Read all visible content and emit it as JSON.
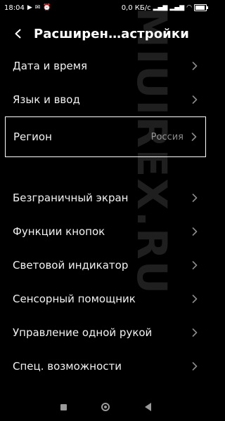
{
  "status": {
    "time": "18:04",
    "left_icons": [
      "play-icon",
      "notification-icon",
      "alarm-icon"
    ],
    "speed": "0,0 КБ/с",
    "right_icons": [
      "signal-icon",
      "signal-icon",
      "wifi-icon",
      "battery-icon"
    ]
  },
  "header": {
    "title": "Расширен…астройки",
    "back_icon": "back-arrow-icon"
  },
  "menu": {
    "items": [
      {
        "label": "Дата и время"
      },
      {
        "label": "Язык и ввод"
      },
      {
        "label": "Регион",
        "value": "Россия"
      },
      {
        "label": "Безграничный экран"
      },
      {
        "label": "Функции кнопок"
      },
      {
        "label": "Световой индикатор"
      },
      {
        "label": "Сенсорный помощник"
      },
      {
        "label": "Управление одной рукой"
      },
      {
        "label": "Спец. возможности"
      }
    ]
  },
  "navbar": {
    "buttons": [
      "recent-apps-icon",
      "home-icon",
      "back-icon"
    ]
  },
  "watermark": {
    "text": "MIUIREX.RU"
  },
  "colors": {
    "background": "#000000",
    "text": "#f2f2f2",
    "secondary": "#8a8a8a",
    "highlight_border": "#ffffff"
  }
}
